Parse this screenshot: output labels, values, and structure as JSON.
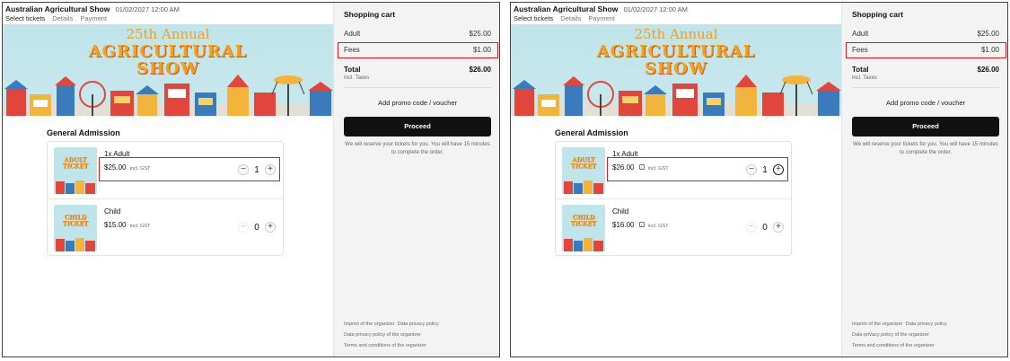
{
  "screens": [
    {
      "app_title": "Australian Agricultural Show",
      "datetime": "01/02/2027 12:00 AM",
      "tabs": [
        "Select tickets",
        "Details",
        "Payment"
      ],
      "banner": {
        "line1": "25th Annual",
        "line2": "AGRICULTURAL",
        "line3": "SHOW"
      },
      "section_title": "General Admission",
      "tickets": [
        {
          "image_line1": "ADULT",
          "image_line2": "TICKET",
          "name": "1x Adult",
          "price": "$25.00",
          "incl": "incl. GST",
          "qty": "1",
          "minus": "−",
          "plus": "+"
        },
        {
          "image_line1": "CHILD",
          "image_line2": "TICKET",
          "name": "Child",
          "price": "$15.00",
          "incl": "incl. GST",
          "qty": "0",
          "minus": "−",
          "plus": "+"
        }
      ],
      "cart": {
        "title": "Shopping cart",
        "adult_label": "Adult",
        "adult_value": "$25.00",
        "fees_label": "Fees",
        "fees_value": "$1.00",
        "total_label": "Total",
        "total_value": "$26.00",
        "incl_taxes": "Incl. Taxes",
        "promo": "Add promo code / voucher",
        "proceed": "Proceed",
        "reserve_note": "We will reserve your tickets for you. You will have 15 minutes to complete the order.",
        "footer": {
          "imprint": "Imprint of the organizer",
          "privacy": "Data privacy policy",
          "privacy_org": "Data privacy policy of the organizer",
          "terms": "Terms and conditions of the organizer"
        }
      }
    },
    {
      "app_title": "Australian Agricultural Show",
      "datetime": "01/02/2027 12:00 AM",
      "tabs": [
        "Select tickets",
        "Details",
        "Payment"
      ],
      "banner": {
        "line1": "25th Annual",
        "line2": "AGRICULTURAL",
        "line3": "SHOW"
      },
      "section_title": "General Admission",
      "tickets": [
        {
          "image_line1": "ADULT",
          "image_line2": "TICKET",
          "name": "1x Adult",
          "price": "$26.00",
          "info": "i",
          "incl": "incl. GST",
          "qty": "1",
          "minus": "−",
          "plus": "+"
        },
        {
          "image_line1": "CHILD",
          "image_line2": "TICKET",
          "name": "Child",
          "price": "$16.00",
          "info": "i",
          "incl": "incl. GST",
          "qty": "0",
          "minus": "−",
          "plus": "+"
        }
      ],
      "cart": {
        "title": "Shopping cart",
        "adult_label": "Adult",
        "adult_value": "$25.00",
        "fees_label": "Fees",
        "fees_value": "$1.00",
        "total_label": "Total",
        "total_value": "$26.00",
        "incl_taxes": "incl. Taxes",
        "promo": "Add promo code / voucher",
        "proceed": "Proceed",
        "reserve_note": "We will reserve your tickets for you. You will have 15 minutes to complete the order.",
        "footer": {
          "imprint": "Imprint of the organizer",
          "privacy": "Data privacy policy",
          "privacy_org": "Data privacy policy of the organizer",
          "terms": "Terms and conditions of the organizer"
        }
      }
    }
  ],
  "colors": {
    "highlight": "#d62020",
    "proceed_bg": "#111111",
    "banner_sky": "#bfe4ea",
    "banner_text": "#f3a21a"
  },
  "icons": [
    "info-icon",
    "minus-icon",
    "plus-icon"
  ]
}
